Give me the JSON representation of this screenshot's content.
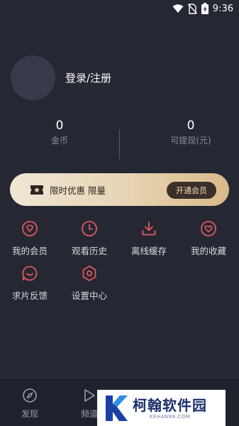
{
  "status_bar": {
    "time": "9:36",
    "icons": [
      "wifi-icon",
      "no-sim-icon",
      "battery-charging-icon"
    ]
  },
  "profile": {
    "login_label": "登录/注册"
  },
  "stats": {
    "coins": {
      "value": "0",
      "label": "金币"
    },
    "withdrawable": {
      "value": "0",
      "label": "可提现(元)"
    }
  },
  "vip_banner": {
    "promo_text": "限时优惠 限量",
    "button_label": "开通会员",
    "icon": "ticket-star-icon"
  },
  "menu": [
    {
      "label": "我的会员",
      "icon": "diamond-icon"
    },
    {
      "label": "观看历史",
      "icon": "clock-icon"
    },
    {
      "label": "离线缓存",
      "icon": "download-icon"
    },
    {
      "label": "我的收藏",
      "icon": "heart-icon"
    },
    {
      "label": "求片反馈",
      "icon": "feedback-chat-icon"
    },
    {
      "label": "设置中心",
      "icon": "settings-hex-icon"
    }
  ],
  "tab_bar": {
    "tabs": [
      {
        "label": "发现",
        "icon": "compass-icon"
      },
      {
        "label": "频道",
        "icon": "play-icon"
      }
    ]
  },
  "watermark": {
    "brand": "柯翰软件园",
    "url": "KEHAN88.COM"
  },
  "colors": {
    "background": "#252833",
    "accent_red": "#e0575f",
    "vip_gold": "#e7d4b3",
    "vip_button": "#3a2f2b"
  }
}
